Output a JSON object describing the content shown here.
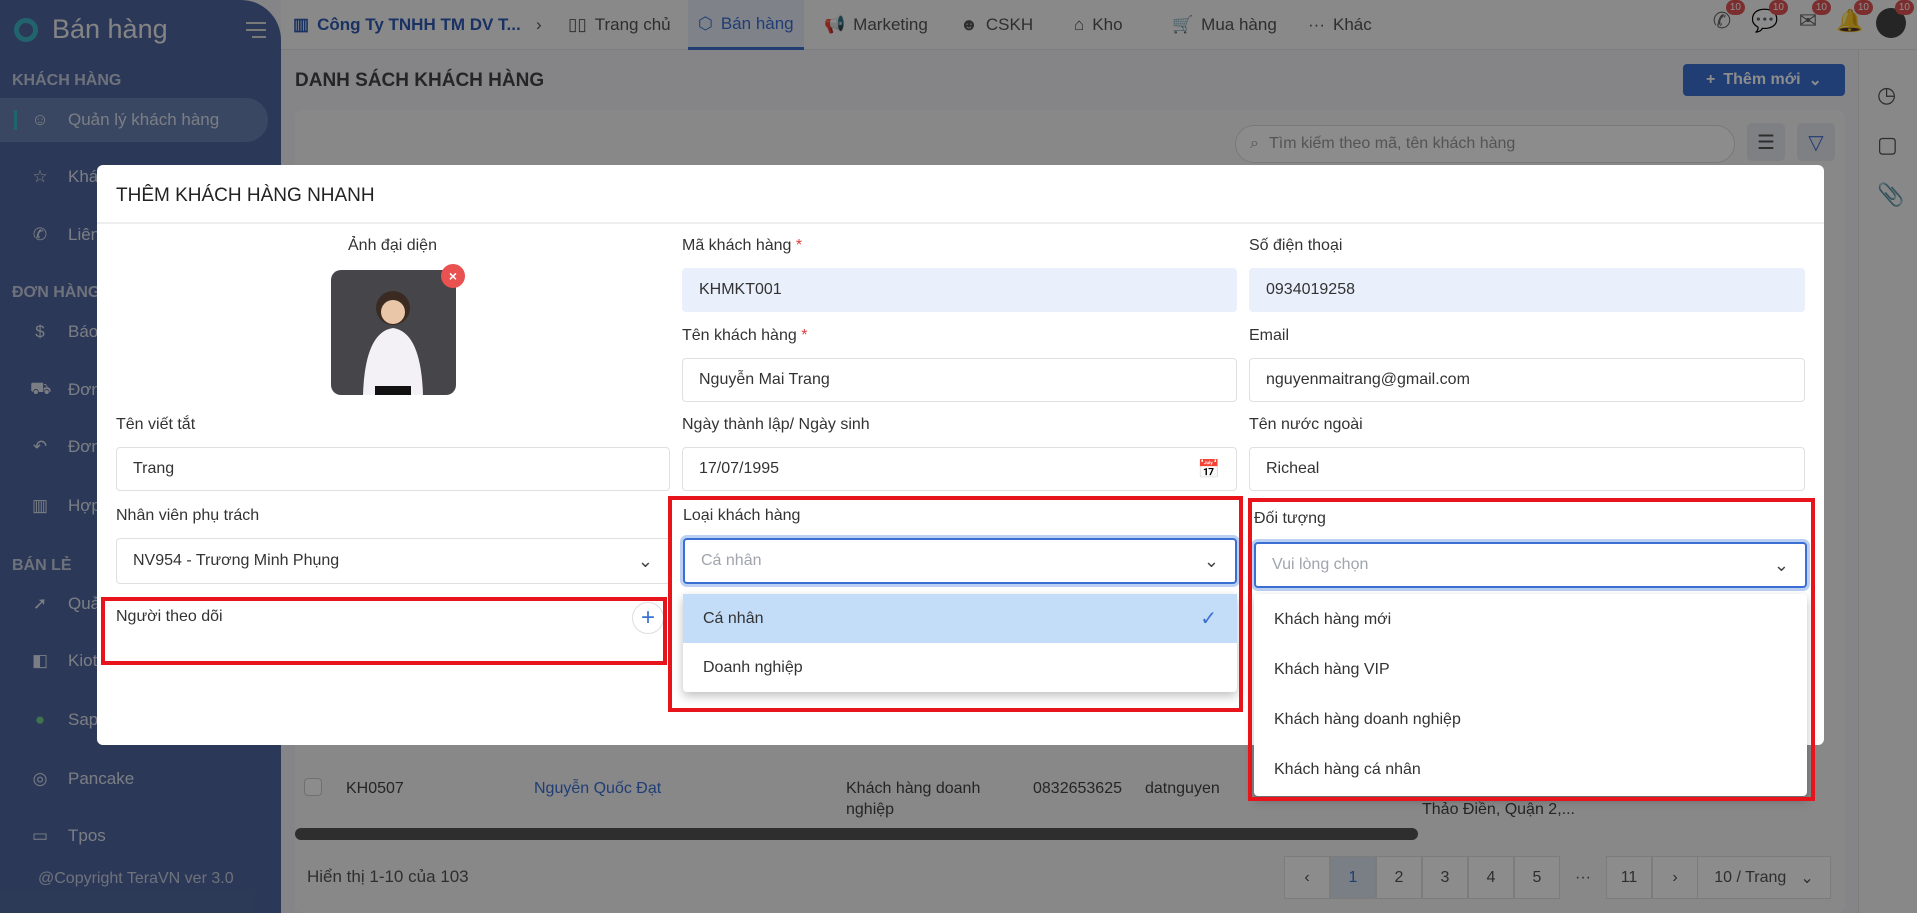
{
  "sidebar": {
    "title": "Bán hàng",
    "sections": [
      {
        "label": "KHÁCH HÀNG",
        "items": [
          {
            "label": "Quản lý khách hàng",
            "icon": "users-icon",
            "active": true
          },
          {
            "label": "Khác",
            "icon": "star-icon"
          },
          {
            "label": "Liên",
            "icon": "phone-icon"
          }
        ]
      },
      {
        "label": "ĐƠN HÀNG",
        "items": [
          {
            "label": "Báo",
            "icon": "dollar-icon"
          },
          {
            "label": "Đơn",
            "icon": "truck-icon"
          },
          {
            "label": "Đơn",
            "icon": "return-icon"
          },
          {
            "label": "Hợp",
            "icon": "store-icon"
          }
        ]
      },
      {
        "label": "BÁN LẺ",
        "items": [
          {
            "label": "Quản",
            "icon": "rocket-icon"
          },
          {
            "label": "Kiot",
            "icon": "kiotviet-icon"
          },
          {
            "label": "Sapo",
            "icon": "sapo-icon"
          },
          {
            "label": "Pancake",
            "icon": "pancake-icon"
          },
          {
            "label": "Tpos",
            "icon": "tpos-icon"
          }
        ]
      }
    ],
    "copyright": "@Copyright TeraVN ver 3.0"
  },
  "topbar": {
    "company": "Công Ty TNHH TM DV T...",
    "nav": [
      {
        "label": "Trang chủ"
      },
      {
        "label": "Bán hàng",
        "active": true
      },
      {
        "label": "Marketing"
      },
      {
        "label": "CSKH"
      },
      {
        "label": "Kho"
      },
      {
        "label": "Mua hàng"
      },
      {
        "label": "Khác"
      }
    ],
    "badges": [
      "10",
      "10",
      "10",
      "10",
      "10"
    ]
  },
  "page": {
    "title": "DANH SÁCH KHÁCH HÀNG",
    "add_button": "Thêm mới",
    "search_placeholder": "Tìm kiếm theo mã, tên khách hàng",
    "row": {
      "code": "KH0507",
      "name": "Nguyễn Quốc Đạt",
      "type": "Khách hàng doanh nghiệp",
      "phone": "0832653625",
      "email": "datnguyen",
      "address": "Thảo Điền, Quận 2,..."
    },
    "footer": "Hiển thị 1-10 của 103",
    "pages": [
      "1",
      "2",
      "3",
      "4",
      "5",
      "···",
      "11"
    ],
    "current_page": "1",
    "page_size": "10 / Trang"
  },
  "modal": {
    "title": "THÊM KHÁCH HÀNG NHANH",
    "avatar_label": "Ảnh đại diện",
    "code_label": "Mã khách hàng",
    "code": "KHMKT001",
    "phone_label": "Số điện thoại",
    "phone": "0934019258",
    "name_label": "Tên khách hàng",
    "name": "Nguyễn Mai Trang",
    "email_label": "Email",
    "email": "nguyenmaitrang@gmail.com",
    "short_label": "Tên viết tắt",
    "short": "Trang",
    "dob_label": "Ngày thành lập/ Ngày sinh",
    "dob": "17/07/1995",
    "foreign_label": "Tên nước ngoài",
    "foreign": "Richeal",
    "staff_label": "Nhân viên phụ trách",
    "staff": "NV954 - Trương Minh Phụng",
    "type_label": "Loại khách hàng",
    "type_value": "Cá nhân",
    "type_options": [
      "Cá nhân",
      "Doanh nghiệp"
    ],
    "target_label": "Đối tượng",
    "target_placeholder": "Vui lòng chọn",
    "target_options": [
      "Khách hàng mới",
      "Khách hàng VIP",
      "Khách hàng doanh nghiệp",
      "Khách hàng cá nhân"
    ],
    "follower_label": "Người theo dõi"
  },
  "colors": {
    "accent": "#3b6fd4",
    "highlight_box": "#e8141c",
    "selected_option": "#c3dcf8"
  }
}
